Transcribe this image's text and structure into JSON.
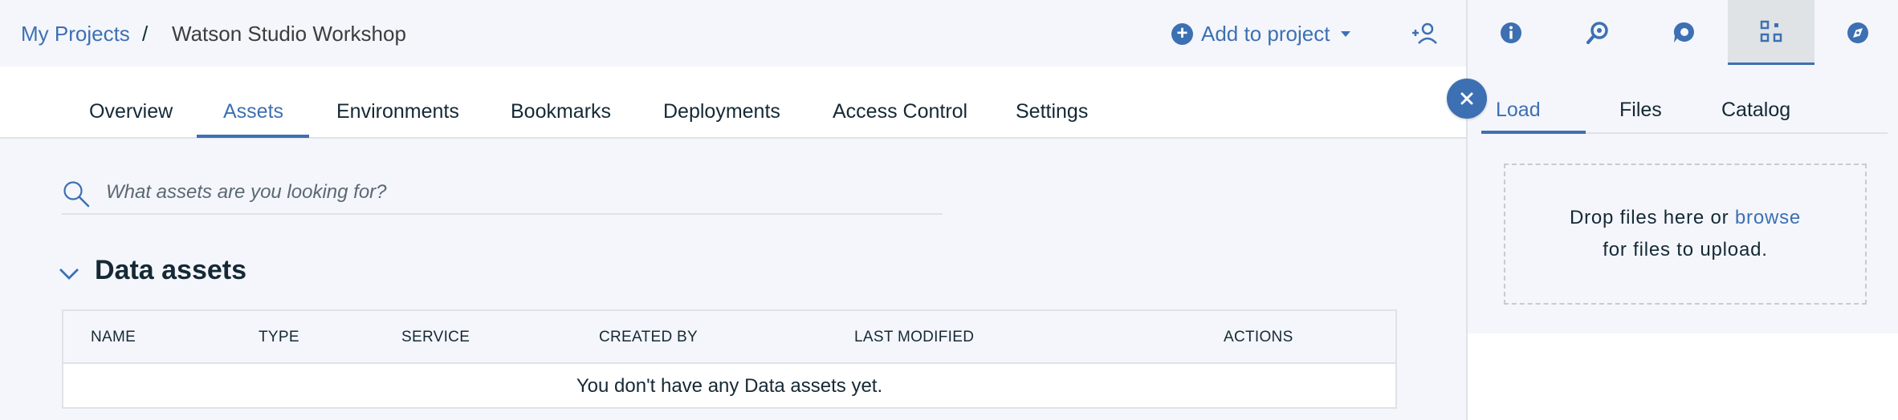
{
  "breadcrumb": {
    "root": "My Projects",
    "separator": "/",
    "current": "Watson Studio Workshop"
  },
  "header": {
    "add_to_project_label": "Add to project",
    "collaborator_icon": "add-collaborator-icon"
  },
  "rail": {
    "icons": [
      "info-icon",
      "find-icon",
      "community-icon",
      "data-icon",
      "compass-icon"
    ],
    "active_index": 3
  },
  "tabs": {
    "items": [
      "Overview",
      "Assets",
      "Environments",
      "Bookmarks",
      "Deployments",
      "Access Control",
      "Settings"
    ],
    "active": "Assets"
  },
  "search": {
    "placeholder": "What assets are you looking for?",
    "value": ""
  },
  "data_assets": {
    "title": "Data assets",
    "columns": [
      "NAME",
      "TYPE",
      "SERVICE",
      "CREATED BY",
      "LAST MODIFIED",
      "ACTIONS"
    ],
    "empty_message": "You don't have any Data assets yet."
  },
  "panel": {
    "tabs": [
      "Load",
      "Files",
      "Catalog"
    ],
    "active_tab": "Load",
    "drop_prefix": "Drop files here or",
    "browse_label": "browse",
    "drop_suffix": "for files to upload."
  },
  "colors": {
    "accent": "#3d70b2",
    "text": "#152935",
    "background": "#f4f6fb",
    "border": "#dfe3e6"
  }
}
